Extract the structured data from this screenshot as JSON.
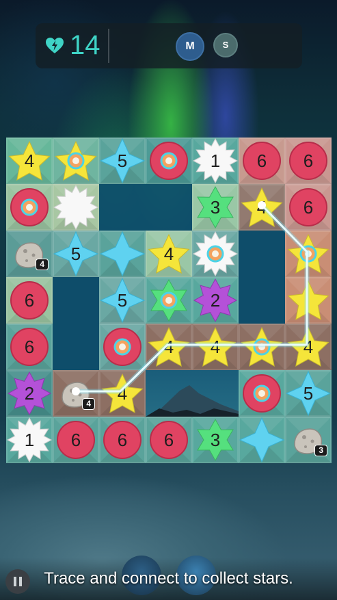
{
  "hud": {
    "moves": "14",
    "players": [
      {
        "initial": "M"
      },
      {
        "initial": "S"
      }
    ]
  },
  "caption": "Trace and connect to collect stars.",
  "colors": {
    "accent": "#3fd4c6",
    "red_orb": "#e04362",
    "yellow_star": "#f5e53a",
    "cyan_star": "#5fd2f0",
    "green_star": "#55e07e",
    "purple_star": "#b451d8"
  },
  "board": {
    "rows": 7,
    "cols": 7,
    "cells": [
      [
        {
          "t": "ystar",
          "v": "4"
        },
        {
          "t": "ystar-ring"
        },
        {
          "t": "cstar",
          "v": "5"
        },
        {
          "t": "orb-ring"
        },
        {
          "t": "wburst",
          "v": "1"
        },
        {
          "t": "orb",
          "v": "6"
        },
        {
          "t": "orb",
          "v": "6"
        }
      ],
      [
        {
          "t": "orb-ring"
        },
        {
          "t": "wburst-arrow-h"
        },
        {
          "t": "gap"
        },
        {
          "t": "gap"
        },
        {
          "t": "gstar",
          "v": "3"
        },
        {
          "t": "ystar",
          "v": "4"
        },
        {
          "t": "orb",
          "v": "6"
        }
      ],
      [
        {
          "t": "rock",
          "badge": "4"
        },
        {
          "t": "cstar",
          "v": "5"
        },
        {
          "t": "cstar-arrow-v"
        },
        {
          "t": "ystar",
          "v": "4"
        },
        {
          "t": "wburst-ring"
        },
        {
          "t": "gap"
        },
        {
          "t": "ystar-ring"
        }
      ],
      [
        {
          "t": "orb",
          "v": "6"
        },
        {
          "t": "gap"
        },
        {
          "t": "cstar",
          "v": "5"
        },
        {
          "t": "gstar-ring"
        },
        {
          "t": "pstar",
          "v": "2"
        },
        {
          "t": "gap"
        },
        {
          "t": "ystar-arrow-h"
        }
      ],
      [
        {
          "t": "orb",
          "v": "6"
        },
        {
          "t": "gap"
        },
        {
          "t": "orb-ring"
        },
        {
          "t": "ystar",
          "v": "4"
        },
        {
          "t": "ystar",
          "v": "4"
        },
        {
          "t": "ystar-ring"
        },
        {
          "t": "ystar",
          "v": "4"
        }
      ],
      [
        {
          "t": "pstar",
          "v": "2"
        },
        {
          "t": "rock",
          "badge": "4"
        },
        {
          "t": "ystar",
          "v": "4"
        },
        {
          "t": "scene"
        },
        {
          "t": "scene"
        },
        {
          "t": "orb-ring"
        },
        {
          "t": "cstar",
          "v": "5"
        }
      ],
      [
        {
          "t": "wburst",
          "v": "1"
        },
        {
          "t": "orb",
          "v": "6"
        },
        {
          "t": "orb",
          "v": "6"
        },
        {
          "t": "orb",
          "v": "6"
        },
        {
          "t": "gstar",
          "v": "3"
        },
        {
          "t": "cstar-arrow-h"
        },
        {
          "t": "rock",
          "badge": "3"
        }
      ]
    ],
    "tileColors": [
      [
        "#66b79a",
        "#6fb5a0",
        "#5aa39b",
        "#4d9b96",
        "#58a89e",
        "#c79a8f",
        "#c99891"
      ],
      [
        "#9ac3a0",
        "#a8c7a3",
        "gap",
        "gap",
        "#9ac7a6",
        "#927a70",
        "#c99891"
      ],
      [
        "#5b9c97",
        "#6aa8a3",
        "#5aa39b",
        "#9ac7a6",
        "#6aa8a3",
        "gap",
        "#c98e75"
      ],
      [
        "#9ac3a0",
        "gap",
        "#6aa8a3",
        "#58a89e",
        "#58a89e",
        "gap",
        "#c98e75"
      ],
      [
        "#5aa39b",
        "gap",
        "#6aa8a3",
        "#8d6f63",
        "#8d6f63",
        "#8d6f63",
        "#8d6f63"
      ],
      [
        "#47908c",
        "#8d6f63",
        "#8d6f63",
        "scene",
        "scene",
        "#58a89e",
        "#5aa39b"
      ],
      [
        "#58a89e",
        "#5aa39b",
        "#5aa39b",
        "#5aa39b",
        "#58a89e",
        "#58a89e",
        "#5aa39b"
      ]
    ],
    "path": [
      [
        1,
        5
      ],
      [
        5,
        5
      ],
      [
        5,
        6
      ],
      [
        7,
        6
      ],
      [
        7,
        5
      ],
      [
        4,
        5
      ],
      [
        4,
        6
      ],
      [
        3,
        8
      ],
      [
        2,
        8
      ]
    ]
  }
}
